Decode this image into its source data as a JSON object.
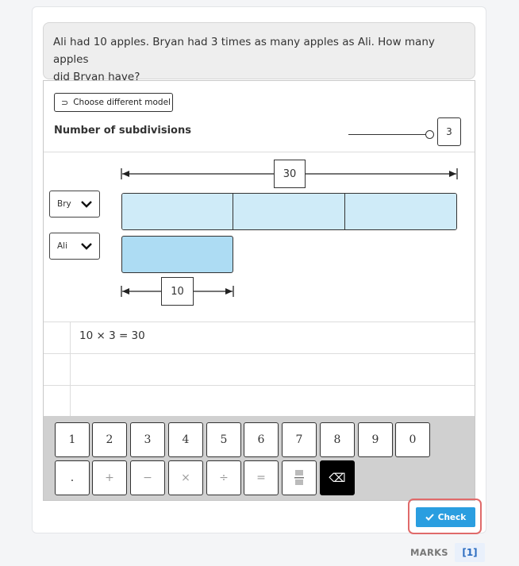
{
  "question": {
    "line1": "Ali had 10 apples. Bryan had 3 times as many apples as Ali. How many apples",
    "line2": "did Bryan have?"
  },
  "model": {
    "choose_label": "Choose different model",
    "subdivisions_label": "Number of subdivisions",
    "subdivisions_value": "3",
    "total_label": "30",
    "unit_label": "10",
    "rows": [
      {
        "selected": "Bry",
        "segments": 3
      },
      {
        "selected": "Ali",
        "segments": 1
      }
    ]
  },
  "working": {
    "lines": [
      "10 × 3 = 30",
      "",
      ""
    ]
  },
  "keypad": {
    "row1": [
      "1",
      "2",
      "3",
      "4",
      "5",
      "6",
      "7",
      "8",
      "9",
      "0"
    ],
    "row2": [
      ".",
      "+",
      "−",
      "×",
      "÷",
      "=",
      "fraction",
      "backspace"
    ]
  },
  "check_label": "Check",
  "marks_label": "MARKS",
  "marks_value": "[1]",
  "colors": {
    "bar_light": "#cfebf8",
    "bar_ali": "#addcf3",
    "keypad_bg": "#d0d0d0",
    "check_blue": "#2a9ee0",
    "highlight_red": "#e06a6a"
  }
}
